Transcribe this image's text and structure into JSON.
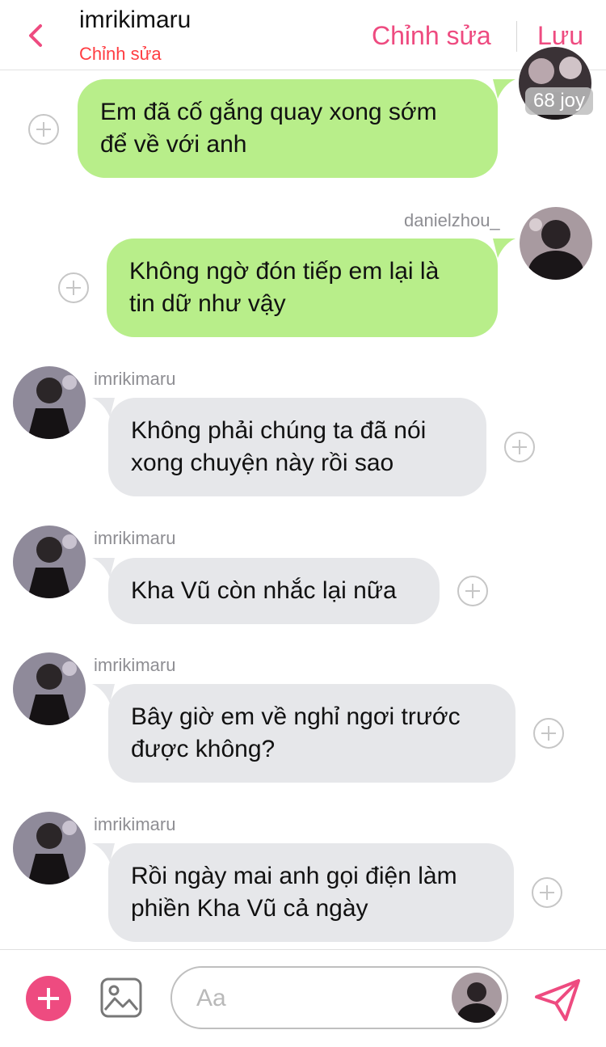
{
  "header": {
    "title": "imrikimaru",
    "subtitle": "Chỉnh sửa",
    "edit_label": "Chỉnh sửa",
    "save_label": "Lưu"
  },
  "top_badge": "68 joy",
  "messages": [
    {
      "sender": "",
      "side": "right",
      "style": "green",
      "lines": [
        "Em đã cố gắng quay xong sớm",
        "để về với anh"
      ]
    },
    {
      "sender": "danielzhou_",
      "side": "right",
      "style": "green",
      "lines": [
        "Không ngờ đón tiếp em lại là",
        "tin dữ như vậy"
      ]
    },
    {
      "sender": "imrikimaru",
      "side": "left",
      "style": "gray",
      "lines": [
        "Không phải chúng ta đã nói",
        "xong chuyện này rồi sao"
      ]
    },
    {
      "sender": "imrikimaru",
      "side": "left",
      "style": "gray",
      "lines": [
        "Kha Vũ còn nhắc lại nữa"
      ]
    },
    {
      "sender": "imrikimaru",
      "side": "left",
      "style": "gray",
      "lines": [
        "Bây giờ em về nghỉ ngơi trước",
        "được không?"
      ]
    },
    {
      "sender": "imrikimaru",
      "side": "left",
      "style": "gray",
      "lines": [
        "Rồi ngày mai anh gọi điện làm",
        "phiền Kha Vũ cả ngày"
      ]
    }
  ],
  "composer": {
    "placeholder": "Aa"
  },
  "icons": {
    "back": "chevron-left-icon",
    "add": "plus-icon",
    "image": "image-icon",
    "send": "send-icon",
    "reaction": "add-reaction-icon"
  },
  "colors": {
    "accent": "#ee4b80",
    "subtitle": "#ff3d42",
    "outgoing_bubble": "#b8ee8a",
    "incoming_bubble": "#e6e7ea"
  }
}
